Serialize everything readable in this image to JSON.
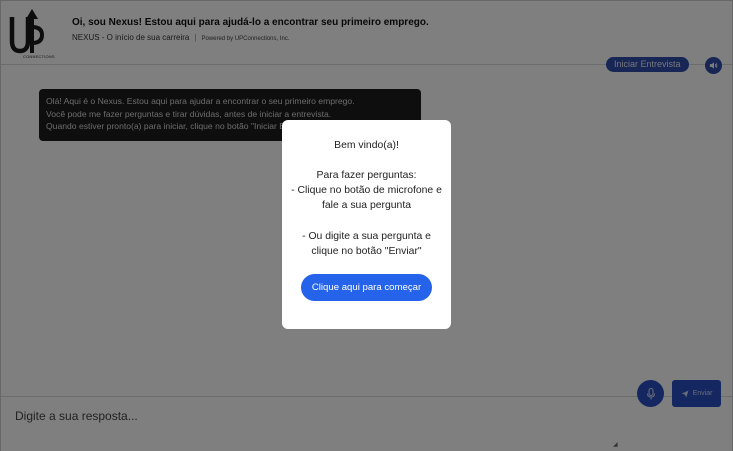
{
  "header": {
    "logo_text": "UP",
    "logo_subtext": "CONNECTIONS",
    "title": "Oi, sou Nexus! Estou aqui para ajudá-lo a encontrar seu primeiro emprego.",
    "subtitle": "NEXUS - O início de sua carreira",
    "separator": "|",
    "powered_by": "Powered by UPConnections, Inc."
  },
  "toolbar": {
    "interview_label": "Iniciar Entrevista",
    "sound_icon": "speaker-icon"
  },
  "chat": {
    "messages": [
      {
        "lines": [
          "Olá! Aqui é o Nexus. Estou aqui para ajudar a encontrar o seu primeiro emprego.",
          "Você pode me fazer perguntas e tirar dúvidas, antes de iniciar a entrevista.",
          "Quando estiver pronto(a) para iniciar, clique no botão \"Iniciar Entrevista\"."
        ]
      }
    ]
  },
  "composer": {
    "placeholder": "Digite a sua resposta...",
    "mic_icon": "microphone-icon",
    "send_icon": "paper-plane-icon",
    "send_label": "Enviar"
  },
  "modal": {
    "welcome": "Bem vindo(a)!",
    "heading": "Para fazer perguntas:",
    "tip1": "- Clique no botão de microfone e fale a sua pergunta",
    "tip2": "- Ou digite a sua pergunta e clique no botão \"Enviar\"",
    "start_label": "Clique aqui para começar"
  },
  "colors": {
    "accent": "#2563eb",
    "button_dark": "#2e4da8",
    "bubble_bg": "#1d1d1d",
    "overlay": "rgba(0,0,0,0.5)"
  }
}
